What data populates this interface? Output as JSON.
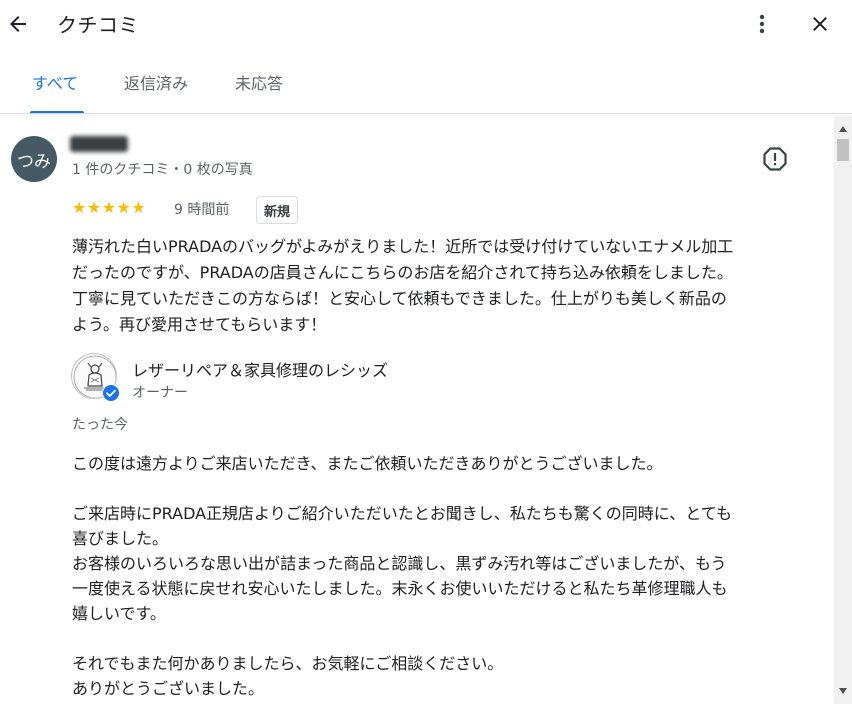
{
  "header": {
    "title": "クチコミ",
    "back_icon": "arrow-back-icon",
    "more_icon": "more-vert-icon",
    "close_icon": "close-icon"
  },
  "tabs": [
    {
      "label": "すべて",
      "active": true
    },
    {
      "label": "返信済み",
      "active": false
    },
    {
      "label": "未応答",
      "active": false
    }
  ],
  "colors": {
    "accent": "#1a73e8",
    "star": "#fbbc04",
    "avatar_bg": "#455a64",
    "verified": "#1a73e8"
  },
  "review": {
    "avatar_text": "つみ",
    "meta": "1 件のクチコミ・0 枚の写真",
    "rating": 5,
    "stars": "★★★★★",
    "time": "9 時間前",
    "badge": "新規",
    "flag_icon": "report-flag-icon",
    "text_lines": [
      "薄汚れた白いPRADAのバッグがよみがえりました！近所では受け付けていないエナメル加工",
      "だったのですが、PRADAの店員さんにこちらのお店を紹介されて持ち込み依頼をしました。",
      "丁寧に見ていただきこの方ならば！と安心して依頼もできました。仕上がりも美しく新品の",
      "よう。再び愛用させてもらいます！"
    ]
  },
  "reply": {
    "owner_name": "レザーリペア＆家具修理のレシッズ",
    "owner_role": "オーナー",
    "time": "たった今",
    "text_lines": [
      "この度は遠方よりご来店いただき、またご依頼いただきありがとうございました。",
      "",
      "ご来店時にPRADA正規店よりご紹介いただいたとお聞きし、私たちも驚くの同時に、とても",
      "喜びました。",
      "お客様のいろいろな思い出が詰まった商品と認識し、黒ずみ汚れ等はございましたが、もう",
      "一度使える状態に戻せれ安心いたしました。末永くお使いいただけると私たち革修理職人も",
      "嬉しいです。",
      "",
      "それでもまた何かありましたら、お気軽にご相談ください。",
      "ありがとうございました。"
    ]
  }
}
